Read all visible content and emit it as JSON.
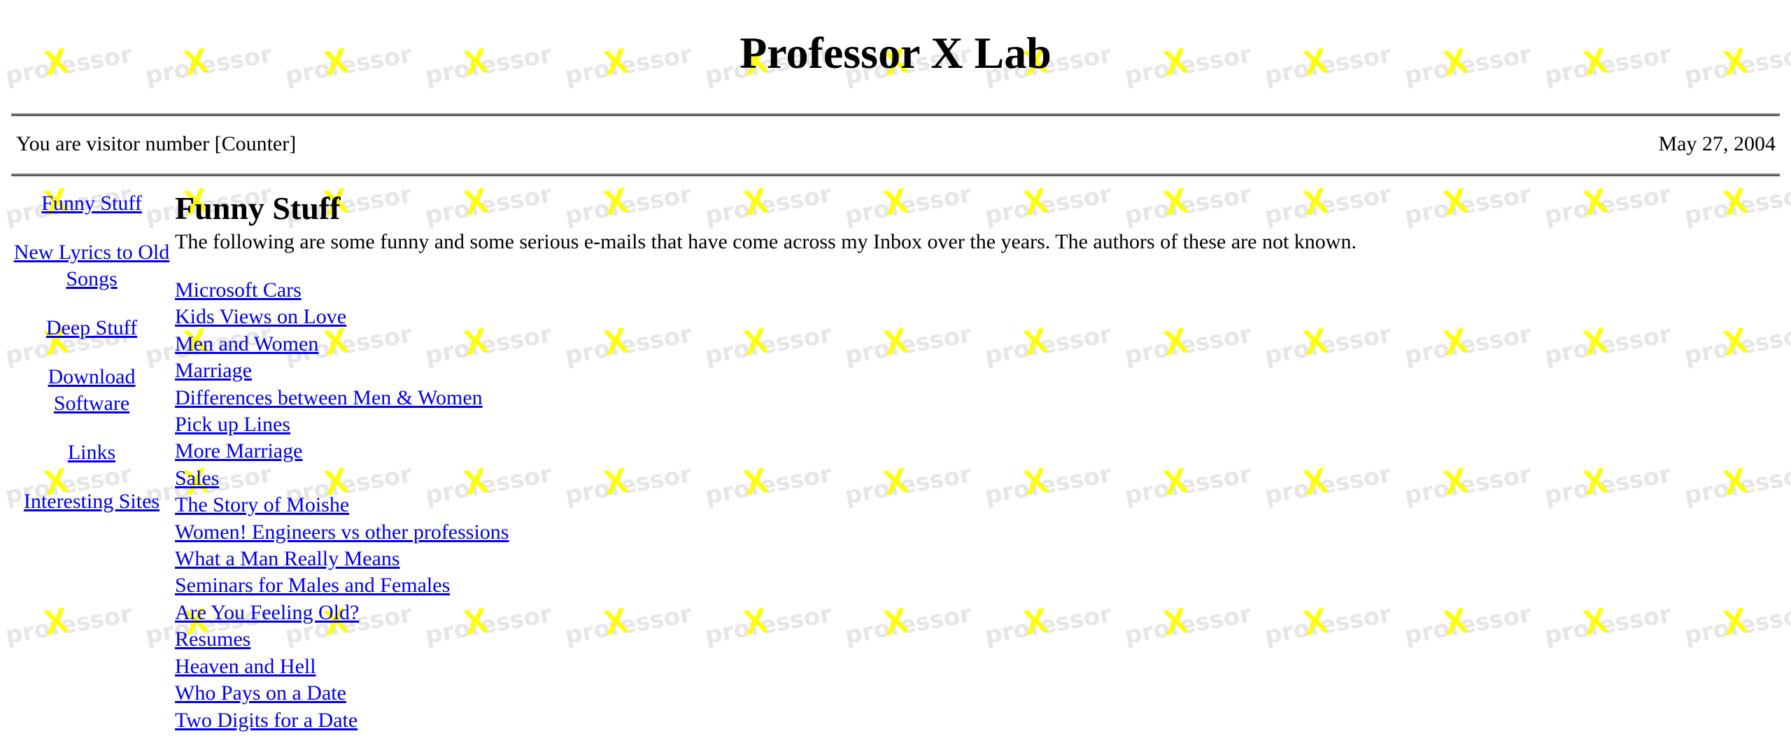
{
  "site": {
    "title": "Professor X Lab",
    "background_watermark": "professor"
  },
  "status_bar": {
    "visitor_text": "You are visitor number [Counter]",
    "date": "May 27, 2004"
  },
  "sidebar": {
    "items": [
      {
        "label": "Funny Stuff"
      },
      {
        "label": "New Lyrics to Old Songs"
      },
      {
        "label": "Deep Stuff"
      },
      {
        "label": "Download Software"
      },
      {
        "label": "Links"
      },
      {
        "label": "Interesting Sites"
      }
    ]
  },
  "main": {
    "heading": "Funny Stuff",
    "intro": "The following are some funny and some serious e-mails that have come across my Inbox over the years. The authors of these are not known.",
    "articles": [
      {
        "label": "Microsoft Cars"
      },
      {
        "label": "Kids Views on Love"
      },
      {
        "label": "Men and Women"
      },
      {
        "label": "Marriage"
      },
      {
        "label": "Differences between Men & Women"
      },
      {
        "label": "Pick up Lines"
      },
      {
        "label": "More Marriage"
      },
      {
        "label": "Sales"
      },
      {
        "label": "The Story of Moishe"
      },
      {
        "label": "Women! Engineers vs other professions"
      },
      {
        "label": "What a Man Really Means"
      },
      {
        "label": "Seminars for Males and Females"
      },
      {
        "label": "Are You Feeling Old?"
      },
      {
        "label": "Resumes"
      },
      {
        "label": "Heaven and Hell"
      },
      {
        "label": "Who Pays on a Date"
      },
      {
        "label": "Two Digits for a Date"
      }
    ]
  },
  "colors": {
    "link": "#0000ee",
    "watermark_text": "#e4e4e4",
    "watermark_x": "#ffff00"
  }
}
